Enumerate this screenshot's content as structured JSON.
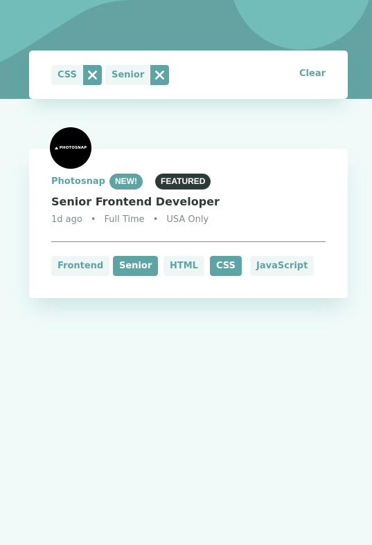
{
  "filters": {
    "chips": [
      {
        "label": "CSS"
      },
      {
        "label": "Senior"
      }
    ],
    "clear_label": "Clear"
  },
  "job": {
    "logo_text": "PHOTOSNAP",
    "company": "Photosnap",
    "badge_new": "NEW!",
    "badge_featured": "FEATURED",
    "position": "Senior Frontend Developer",
    "posted_at": "1d ago",
    "separator": "•",
    "contract": "Full Time",
    "location": "USA Only",
    "tags": [
      {
        "label": "Frontend",
        "active": false
      },
      {
        "label": "Senior",
        "active": true
      },
      {
        "label": "HTML",
        "active": false
      },
      {
        "label": "CSS",
        "active": true
      },
      {
        "label": "JavaScript",
        "active": false
      }
    ]
  },
  "colors": {
    "primary": "#5fa4a4",
    "dark": "#2c3a3a",
    "background": "#f0faf9",
    "filter_tablet": "#eef6f6"
  }
}
